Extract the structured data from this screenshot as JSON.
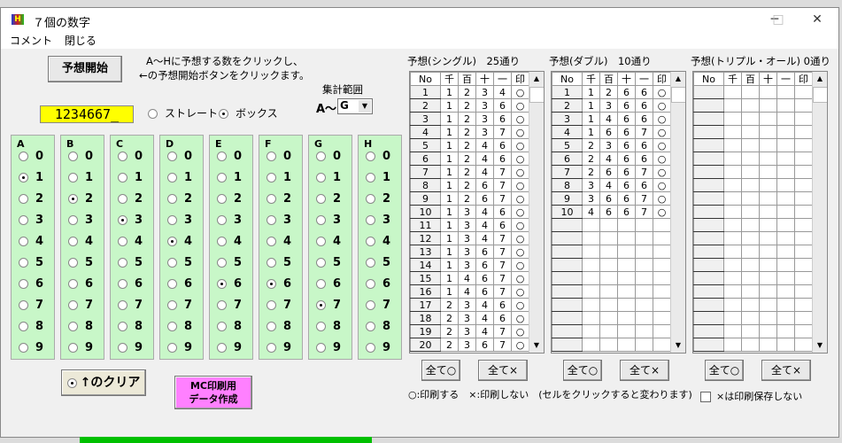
{
  "window": {
    "title": "７個の数字",
    "icon_text": "H",
    "minimize": "─",
    "maximize": "□",
    "close": "✕"
  },
  "menu": [
    "コメント",
    "閉じる"
  ],
  "start_button": "予想開始",
  "instructions": [
    "A～Hに予想する数をクリックし、",
    "←の予想開始ボタンをクリックます。"
  ],
  "range": {
    "label": "集計範囲",
    "prefix": "A～",
    "value": "G"
  },
  "number_display": "1234667_",
  "mode": {
    "straight": "ストレート",
    "box": "ボックス",
    "selected": "box"
  },
  "columns": [
    {
      "label": "A",
      "selected": 1
    },
    {
      "label": "B",
      "selected": 2
    },
    {
      "label": "C",
      "selected": 3
    },
    {
      "label": "D",
      "selected": 4
    },
    {
      "label": "E",
      "selected": 6
    },
    {
      "label": "F",
      "selected": 6
    },
    {
      "label": "G",
      "selected": 7
    },
    {
      "label": "H",
      "selected": null
    }
  ],
  "digits": [
    "0",
    "1",
    "2",
    "3",
    "4",
    "5",
    "6",
    "7",
    "8",
    "9"
  ],
  "clear_button": "↑のクリア",
  "mc_button": [
    "MC印刷用",
    "データ作成"
  ],
  "table_headers": [
    "No",
    "千",
    "百",
    "十",
    "一",
    "印"
  ],
  "tables": [
    {
      "title": "予想(シングル)　25通り",
      "rows": [
        [
          "1",
          "1",
          "2",
          "3",
          "4",
          "○"
        ],
        [
          "2",
          "1",
          "2",
          "3",
          "6",
          "○"
        ],
        [
          "3",
          "1",
          "2",
          "3",
          "6",
          "○"
        ],
        [
          "4",
          "1",
          "2",
          "3",
          "7",
          "○"
        ],
        [
          "5",
          "1",
          "2",
          "4",
          "6",
          "○"
        ],
        [
          "6",
          "1",
          "2",
          "4",
          "6",
          "○"
        ],
        [
          "7",
          "1",
          "2",
          "4",
          "7",
          "○"
        ],
        [
          "8",
          "1",
          "2",
          "6",
          "7",
          "○"
        ],
        [
          "9",
          "1",
          "2",
          "6",
          "7",
          "○"
        ],
        [
          "10",
          "1",
          "3",
          "4",
          "6",
          "○"
        ],
        [
          "11",
          "1",
          "3",
          "4",
          "6",
          "○"
        ],
        [
          "12",
          "1",
          "3",
          "4",
          "7",
          "○"
        ],
        [
          "13",
          "1",
          "3",
          "6",
          "7",
          "○"
        ],
        [
          "14",
          "1",
          "3",
          "6",
          "7",
          "○"
        ],
        [
          "15",
          "1",
          "4",
          "6",
          "7",
          "○"
        ],
        [
          "16",
          "1",
          "4",
          "6",
          "7",
          "○"
        ],
        [
          "17",
          "2",
          "3",
          "4",
          "6",
          "○"
        ],
        [
          "18",
          "2",
          "3",
          "4",
          "6",
          "○"
        ],
        [
          "19",
          "2",
          "3",
          "4",
          "7",
          "○"
        ],
        [
          "20",
          "2",
          "3",
          "6",
          "7",
          "○"
        ]
      ]
    },
    {
      "title": "予想(ダブル)　10通り",
      "rows": [
        [
          "1",
          "1",
          "2",
          "6",
          "6",
          "○"
        ],
        [
          "2",
          "1",
          "3",
          "6",
          "6",
          "○"
        ],
        [
          "3",
          "1",
          "4",
          "6",
          "6",
          "○"
        ],
        [
          "4",
          "1",
          "6",
          "6",
          "7",
          "○"
        ],
        [
          "5",
          "2",
          "3",
          "6",
          "6",
          "○"
        ],
        [
          "6",
          "2",
          "4",
          "6",
          "6",
          "○"
        ],
        [
          "7",
          "2",
          "6",
          "6",
          "7",
          "○"
        ],
        [
          "8",
          "3",
          "4",
          "6",
          "6",
          "○"
        ],
        [
          "9",
          "3",
          "6",
          "6",
          "7",
          "○"
        ],
        [
          "10",
          "4",
          "6",
          "6",
          "7",
          "○"
        ]
      ]
    },
    {
      "title": "予想(トリプル・オール) 0通り",
      "rows": []
    }
  ],
  "all_on": "全て○",
  "all_off": "全て×",
  "legend": "○:印刷する　×:印刷しない　(セルをクリックすると変わります)",
  "no_save_checkbox": {
    "label": "×は印刷保存しない",
    "checked": false
  }
}
